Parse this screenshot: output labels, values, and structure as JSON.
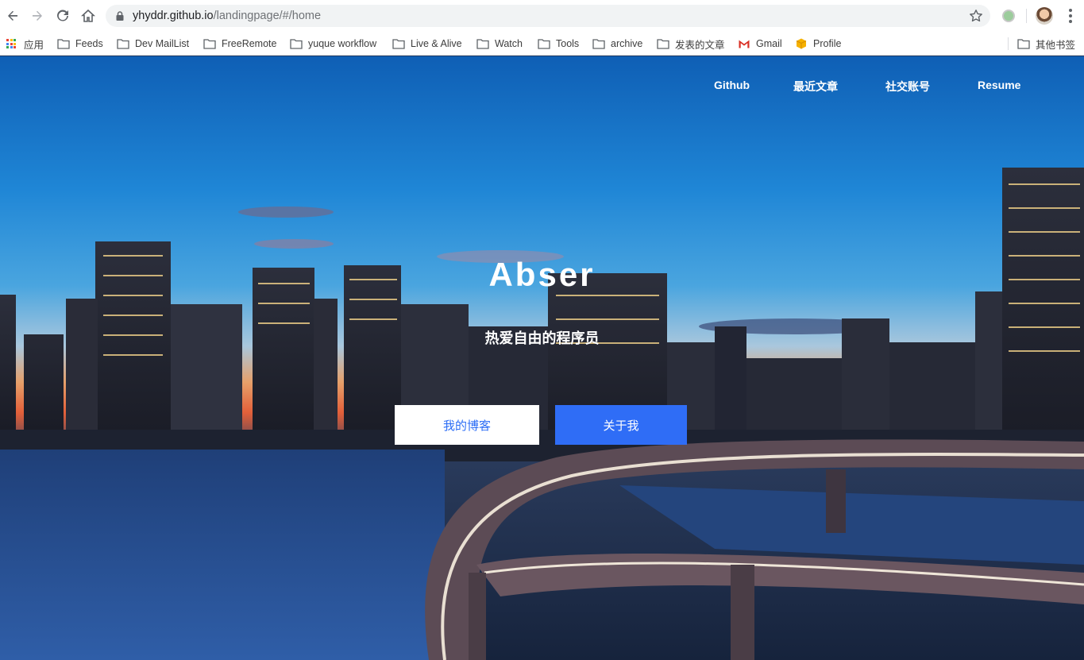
{
  "browser": {
    "url_host": "yhyddr.github.io",
    "url_path": "/landingpage/#/home",
    "icons": [
      "back-icon",
      "forward-icon",
      "reload-icon",
      "home-icon",
      "lock-icon",
      "star-icon",
      "extension-icon",
      "avatar",
      "menu-icon"
    ]
  },
  "bookmarks": {
    "apps_label": "应用",
    "items": [
      "Feeds",
      "Dev MailList",
      "FreeRemote",
      "yuque workflow",
      "Live & Alive",
      "Watch",
      "Tools",
      "archive",
      "发表的文章",
      "Gmail",
      "Profile"
    ],
    "other_label": "其他书签"
  },
  "page": {
    "nav": [
      "Github",
      "最近文章",
      "社交账号",
      "Resume"
    ],
    "title": "Abser",
    "tagline": "热爱自由的程序员",
    "buttons": {
      "blog": "我的博客",
      "about": "关于我"
    }
  },
  "colors": {
    "accent": "#2f6df6",
    "sky_top": "#0f5fb5",
    "sunset": "#e3603a"
  }
}
